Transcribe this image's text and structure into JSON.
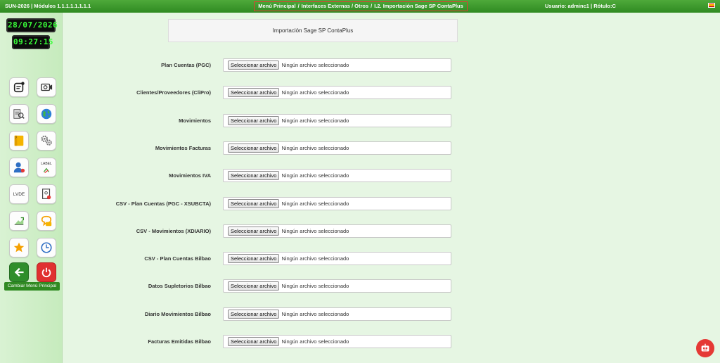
{
  "topbar": {
    "system": "SUN-2026 | Módulos 1.1.1.1.1.1.1.1",
    "breadcrumb": {
      "item1": "Menú Principal",
      "item2": "Interfaces Externas / Otros",
      "item3": "I.2. Importación Sage SP ContaPlus",
      "separator": "/"
    },
    "user": "Usuario: adminc1 | Rótulo:C"
  },
  "sidebar": {
    "date": "28/07/2026",
    "time": "09:27:15",
    "lvde_label": "LVDE",
    "label_text": "LABEL",
    "cambiar": "Cambiar Menú Principal"
  },
  "main": {
    "title": "Importación Sage SP ContaPlus",
    "button_label": "Seleccionar archivo",
    "no_file": "Ningún archivo seleccionado",
    "rows": [
      "Plan Cuentas (PGC)",
      "Clientes/Proveedores (CliPro)",
      "Movimientos",
      "Movimientos Facturas",
      "Movimientos IVA",
      "CSV - Plan Cuentas (PGC - XSUBCTA)",
      "CSV - Movimientos (XDIARIO)",
      "CSV - Plan Cuentas Bilbao",
      "Datos Supletorios Bilbao",
      "Diario Movimientos Bilbao",
      "Facturas Emitidas Bilbao"
    ]
  },
  "colors": {
    "topbar": "#2f8a22",
    "background": "#e6f6e3",
    "highlight_border": "#e53935",
    "clock_digits": "#3aff3a"
  }
}
